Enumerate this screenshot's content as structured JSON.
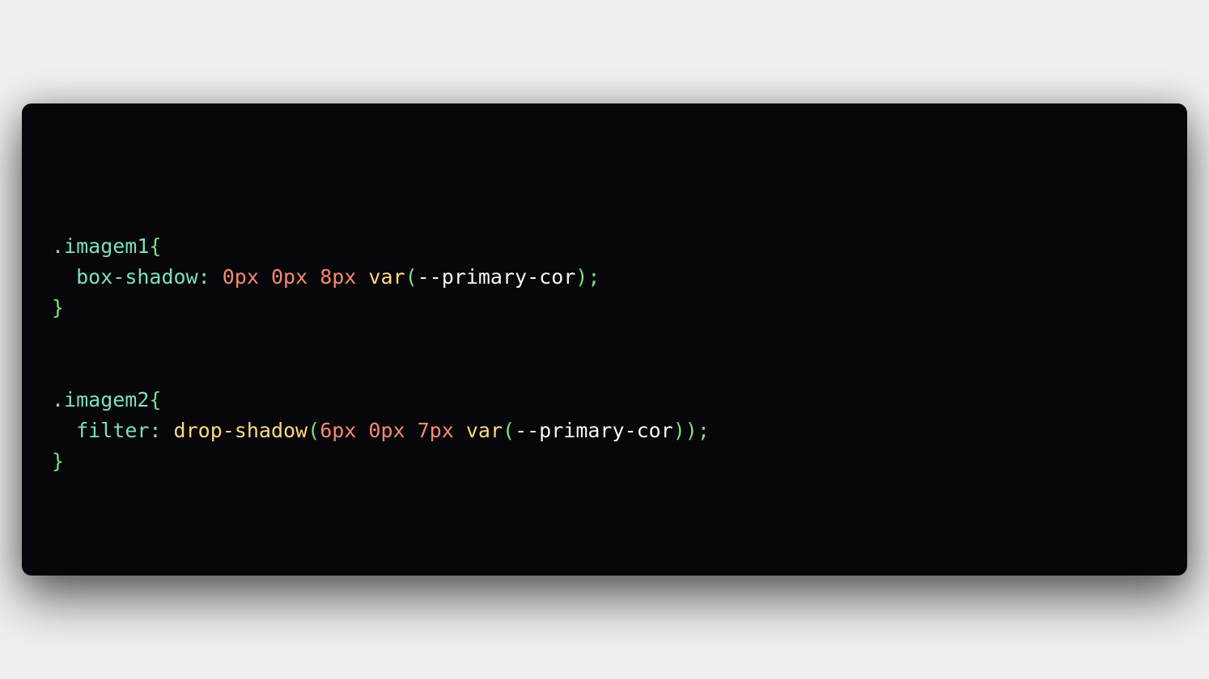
{
  "colors": {
    "background": "#efefef",
    "editor_background": "#06060b",
    "selector": "#7ee0b8",
    "brace": "#7ee07a",
    "property": "#7ee0b8",
    "number": "#f58a6f",
    "function": "#ffd97d",
    "variable": "#f5f5f5"
  },
  "code": {
    "rule1": {
      "selector": ".imagem1",
      "open": "{",
      "property": "box-shadow",
      "colon": ":",
      "v1": "0px",
      "v2": "0px",
      "v3": "8px",
      "func": "var",
      "paren_open": "(",
      "variable": "--primary-cor",
      "end": ");",
      "close": "}"
    },
    "rule2": {
      "selector": ".imagem2",
      "open": "{",
      "property": "filter",
      "colon": ":",
      "outer_func": "drop-shadow",
      "outer_paren_open": "(",
      "v1": "6px",
      "v2": "0px",
      "v3": "7px",
      "func": "var",
      "paren_open": "(",
      "variable": "--primary-cor",
      "end": "));",
      "close": "}"
    }
  }
}
